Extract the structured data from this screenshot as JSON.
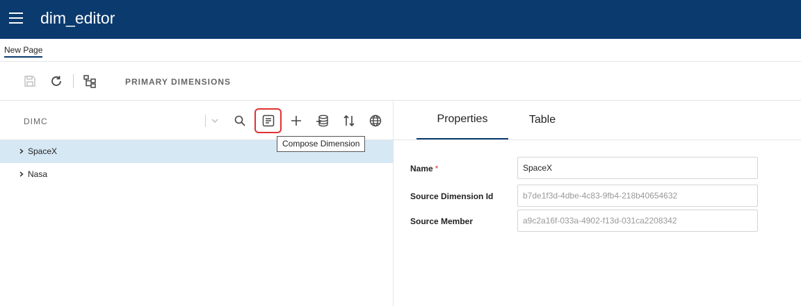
{
  "app": {
    "title": "dim_editor"
  },
  "page_tabs": [
    {
      "label": "New Page"
    }
  ],
  "toolbar": {
    "section_label": "PRIMARY DIMENSIONS",
    "icons": [
      "save-icon",
      "refresh-icon",
      "hierarchy-icon"
    ]
  },
  "dimension_panel": {
    "label": "DIMC",
    "tools": [
      "chevron-down-icon",
      "search-icon",
      "compose-icon",
      "plus-icon",
      "database-import-icon",
      "sort-icon",
      "globe-icon"
    ],
    "tooltip": "Compose Dimension",
    "tree": [
      {
        "label": "SpaceX",
        "selected": true
      },
      {
        "label": "Nasa",
        "selected": false
      }
    ]
  },
  "details": {
    "tabs": [
      {
        "label": "Properties",
        "active": true
      },
      {
        "label": "Table",
        "active": false
      }
    ],
    "fields": [
      {
        "label": "Name",
        "required_mark": "*",
        "value": "SpaceX"
      },
      {
        "label": "Source Dimension Id",
        "value": "b7de1f3d-4dbe-4c83-9fb4-218b40654632"
      },
      {
        "label": "Source Member",
        "value": "a9c2a16f-033a-4902-f13d-031ca2208342"
      }
    ]
  },
  "colors": {
    "appbar": "#0a3a6e",
    "selection": "#d7e8f5",
    "highlight": "#e03131"
  }
}
